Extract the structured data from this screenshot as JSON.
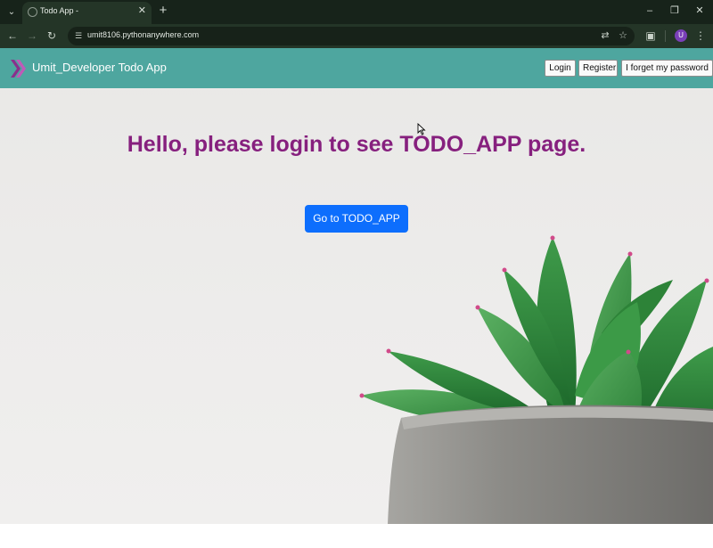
{
  "browser": {
    "tab_title": "Todo App -",
    "tab_favicon": "globe-icon",
    "url": "umit8106.pythonanywhere.com",
    "profile_initial": "U",
    "icons": {
      "tab_list": "chevron-down-icon",
      "tab_close": "close-icon",
      "new_tab": "plus-icon",
      "back": "arrow-left-icon",
      "forward": "arrow-right-icon",
      "reload": "reload-icon",
      "site_info": "tune-icon",
      "translate": "translate-icon",
      "bookmark": "star-icon",
      "extensions": "puzzle-icon",
      "menu": "kebab-menu-icon",
      "minimize": "minimize-icon",
      "restore": "restore-icon",
      "close_window": "close-icon"
    }
  },
  "navbar": {
    "brand_name": "Umit_Developer Todo App",
    "brand_logo": "chevron-logo-icon",
    "buttons": {
      "login": "Login",
      "register": "Register",
      "forgot": "I forget my password"
    }
  },
  "main": {
    "heading": "Hello, please login to see TODO_APP page.",
    "cta_label": "Go to TODO_APP"
  },
  "colors": {
    "navbar_bg": "#4ea69f",
    "heading": "#86207e",
    "cta_bg": "#0d6efd",
    "chrome_bg": "#17231a"
  }
}
